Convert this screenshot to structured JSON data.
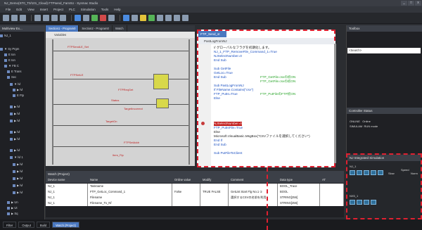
{
  "window": {
    "title": "NJ_Demo(ST0_T0/101_Cloud) FTPsend_FamSU - Sysmac Studio",
    "buttons": [
      "_",
      "□",
      "x"
    ]
  },
  "menu": [
    "File",
    "Edit",
    "View",
    "Insert",
    "Project",
    "PLC",
    "Simulation",
    "Tools",
    "Help"
  ],
  "toolbar": {
    "icons": [
      "save-icon",
      "undo-icon",
      "redo-icon",
      "cut-icon",
      "copy-icon",
      "paste-icon",
      "search-icon",
      "online-icon",
      "transfer-icon",
      "run-icon",
      "stop-icon",
      "zoom-icon",
      "simulate-icon",
      "gear-icon",
      "warning-icon",
      "play-icon",
      "pause-icon",
      "step-icon"
    ]
  },
  "multiview": {
    "title": "Multiview Ex...",
    "items": [
      "NJ_1",
      "▼ Sy Prgm",
      "E Ion",
      "E Ion",
      "▼ FB C",
      "E Trans",
      "Sec",
      "▼ lvl",
      "▶ lvl",
      "E Ftp",
      "▶ lvl",
      "▶ lvl",
      "▶ lvl",
      "▶ lvl",
      "▶ lvl",
      "▶ lvl",
      "▼ lvl 1",
      "▶ lvl",
      "▶ lvl",
      "▶ lvl",
      "▶ lvl",
      "▶ lvl",
      "▶ Un",
      "▶ Ut",
      "▶ Sq"
    ]
  },
  "tabs": [
    "Section1 - Program0",
    "Section2 - Program0",
    "Watch"
  ],
  "ladder": {
    "header": "Variables",
    "labels": [
      "FTPSendLE_Set",
      "FTPSetLE",
      "FTPReqGet",
      "Status",
      "TargetIncorrect",
      "TargetOn",
      "FTPSetAddr",
      "Item_Ftp"
    ]
  },
  "st": {
    "tab": "FTP_Send_st",
    "path": "PastLogFromNJ",
    "lines": [
      {
        "text": "// グローバルなフラグを初期化します。",
        "cls": "cmt"
      },
      {
        "text": "  NJ_1_FTP_RemoveFile_Command_1=True",
        "cls": "kw"
      },
      {
        "text": "  NJSelectNumber=0",
        "cls": "kw"
      },
      {
        "text": "End Sub",
        "cls": "kw"
      },
      {
        "text": "",
        "cls": ""
      },
      {
        "text": "Sub GetFile",
        "cls": "kw"
      },
      {
        "text": "  GetLoc=True",
        "cls": "kw"
      },
      {
        "text": "End Sub",
        "cls": "kw"
      },
      {
        "text": "",
        "cls": ""
      },
      {
        "text": "Sub PastLogFromNJ",
        "cls": "kw"
      },
      {
        "text": "  If FileName.Contains(\"csv\")",
        "cls": "kw"
      },
      {
        "text": "  FTP_PutIs=True",
        "cls": "kw"
      },
      {
        "text": "  Else",
        "cls": "kw"
      },
      {
        "text": "  NJSelectNumber=0",
        "cls": "hl"
      },
      {
        "text": "  FTP_PutIsFile=True",
        "cls": "kw"
      },
      {
        "text": "  Else",
        "cls": ""
      },
      {
        "text": "  Microsoft.VisualBasic.MsgBox(\"CSVファイルを選択してください\")",
        "cls": ""
      },
      {
        "text": "  End If",
        "cls": "kw"
      },
      {
        "text": "End Sub",
        "cls": "kw"
      },
      {
        "text": "",
        "cls": ""
      },
      {
        "text": "Sub PutFileToClient",
        "cls": "kw"
      }
    ],
    "inline_comments": [
      "FTP_GetFile.csvの初ON",
      "FTP_GetFile.csvの初ON",
      "FTP_PutFileのFTP初ON"
    ]
  },
  "toolbox": {
    "title": "Toolbox",
    "select": "<Search>"
  },
  "controller": {
    "title": "Controller Status",
    "rows": [
      [
        "ONLINE",
        "Online"
      ],
      [
        "SIMULAM",
        "RUN mode"
      ]
    ]
  },
  "simulation": {
    "title": "NJ Integrated Simulation",
    "sub1": "NJ_1",
    "sub2": "NX5_1",
    "labels": [
      "Slow",
      "Speed",
      "Norm"
    ]
  },
  "watch": {
    "title": "Watch (Project)",
    "columns": [
      "Device name",
      "Name",
      "Online value",
      "Modify",
      "Comment",
      "Data type",
      "AT"
    ],
    "rows": [
      [
        "NJ_1",
        "Taskname",
        "",
        "",
        "",
        "BOOL_Trace",
        ""
      ],
      [
        "NJ_1",
        "FTP_GetLoc_Command_1",
        "False",
        "TRUE FALSE",
        "GetList Start Flg No.1 ①",
        "BOOL",
        ""
      ],
      [
        "NJ_1",
        "Filename",
        "",
        "",
        "選択するCSVの名前を利用",
        "STRING[256]",
        ""
      ],
      [
        "NJ_1",
        "Filename_To_Nf",
        "",
        "",
        "",
        "STRING[256]",
        ""
      ]
    ]
  },
  "bottom": [
    "Filter",
    "Output",
    "Build",
    "Watch (Project)"
  ]
}
